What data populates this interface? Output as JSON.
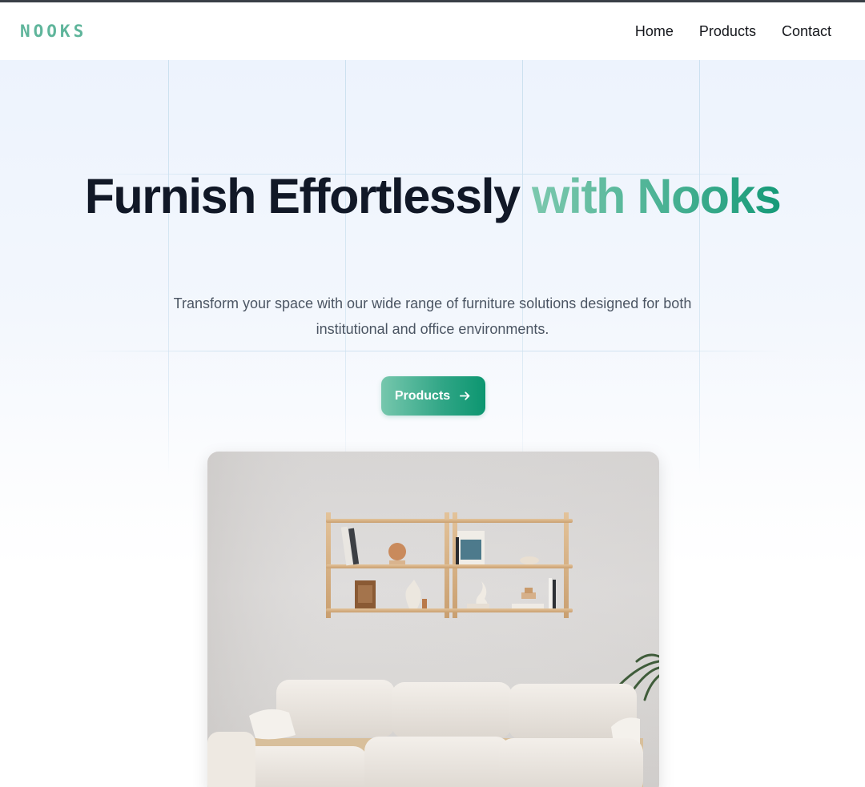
{
  "brand": {
    "logo_text": "NOOKS",
    "accent_color": "#5fb59b"
  },
  "nav": {
    "items": [
      {
        "label": "Home"
      },
      {
        "label": "Products"
      },
      {
        "label": "Contact"
      }
    ]
  },
  "hero": {
    "title_main": "Furnish Effortlessly ",
    "title_accent": "with Nooks",
    "subtitle": "Transform your space with our wide range of furniture solutions designed for both institutional and office environments.",
    "cta_label": "Products",
    "cta_icon": "arrow-right-icon",
    "image_subject": "living room with white sofa and wooden wall shelf"
  },
  "colors": {
    "heading": "#111827",
    "subtitle": "#4b5563",
    "button_gradient_start": "#76c7ad",
    "button_gradient_end": "#0c9670",
    "background_top": "#edf3fd"
  }
}
